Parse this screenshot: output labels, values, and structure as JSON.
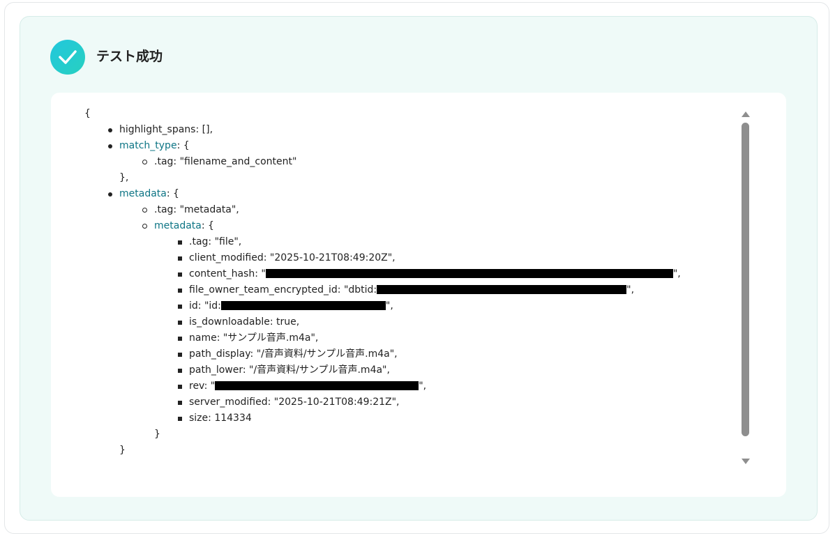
{
  "header": {
    "title": "テスト成功"
  },
  "code": {
    "open_brace": "{",
    "highlight_spans": "highlight_spans: [],",
    "match_type_key": "match_type",
    "match_type_open": ": {",
    "match_type_tag": ".tag: \"filename_and_content\"",
    "match_type_close": "},",
    "metadata_key": "metadata",
    "metadata_open": ": {",
    "metadata_tag": ".tag: \"metadata\",",
    "inner_metadata_key": "metadata",
    "inner_metadata_open": ": {",
    "fields": {
      "tag": ".tag: \"file\",",
      "client_modified": "client_modified: \"2025-10-21T08:49:20Z\",",
      "content_hash_prefix": "content_hash: \"",
      "content_hash_suffix": "\",",
      "file_owner_prefix": "file_owner_team_encrypted_id: \"dbtid:",
      "file_owner_suffix": "\",",
      "id_prefix": "id: \"id:",
      "id_suffix": "\",",
      "is_downloadable": "is_downloadable: true,",
      "name": "name: \"サンプル音声.m4a\",",
      "path_display": "path_display: \"/音声資料/サンプル音声.m4a\",",
      "path_lower": "path_lower: \"/音声資料/サンプル音声.m4a\",",
      "rev_prefix": "rev: \"",
      "rev_suffix": "\",",
      "server_modified": "server_modified: \"2025-10-21T08:49:21Z\",",
      "size": "size: 114334"
    },
    "inner_close": "}",
    "outer_close": "}"
  },
  "colors": {
    "accent": "#27d0c0",
    "key_link": "#0e7585",
    "panel_bg": "#effaf8"
  }
}
